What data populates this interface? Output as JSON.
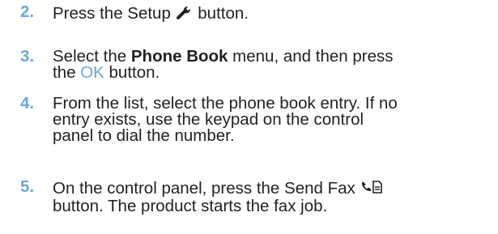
{
  "steps": [
    {
      "number": "2.",
      "before_icon": "Press the Setup",
      "icon": "wrench-icon",
      "after_icon": "button."
    },
    {
      "number": "3.",
      "before_bold": "Select the",
      "bold": "Phone Book",
      "after_bold": "menu, and then press",
      "line2_before": "the",
      "accent": "OK",
      "line2_after": "button."
    },
    {
      "number": "4.",
      "line1": "From the list, select the phone book entry. If no",
      "line2": "entry exists, use the keypad on the control",
      "line3": "panel to dial the number."
    },
    {
      "number": "5.",
      "before_icon": "On the control panel, press the Send Fax",
      "icon": "send-fax-icon",
      "line2": "button. The product starts the fax job."
    }
  ],
  "colors": {
    "text": "#231f20",
    "accent": "#6aa8dc"
  }
}
